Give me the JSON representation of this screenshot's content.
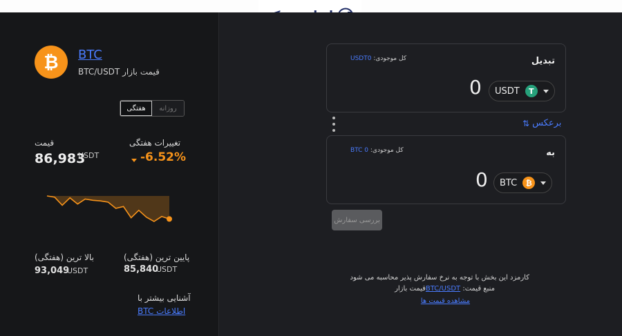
{
  "header": {
    "logo_text": "ایران بروکر"
  },
  "market": {
    "symbol": "BTC",
    "pair_name": "قیمت بازار BTC/USDT",
    "period_options": [
      "روزانه",
      "هفتگی"
    ],
    "active_period": "هفتگی",
    "weekly_change_label": "تغییرات هفتگی",
    "weekly_change": "-6.52%",
    "price_label": "قیمت",
    "price": "86,983",
    "price_unit": "USDT",
    "low_label": "پایین ترین (هفتگی)",
    "low_value": "85,840",
    "low_unit": "USDT",
    "high_label": "بالا ترین (هفتگی)",
    "high_value": "93,049",
    "high_unit": "USDT",
    "more_label": "آشنایی بیشتر با",
    "more_link": "اطلاعات BTC",
    "sparkline": [
      95,
      93,
      80,
      92,
      82,
      90,
      88,
      87,
      85,
      75,
      78,
      60,
      72,
      61,
      54,
      62,
      58
    ]
  },
  "colors": {
    "btc": "#f7931a",
    "usdt": "#26a17b",
    "accent": "#4a7cff"
  },
  "convert": {
    "from_title": "تبدیل",
    "from_balance_label": "کل موجودی:",
    "from_balance_value": "USDT0",
    "from_amount": "0",
    "from_coin": "USDT",
    "from_coin_icon": "tether-icon",
    "swap_label": "برعکس",
    "to_title": "به",
    "to_balance_label": "کل موجودی:",
    "to_balance_value": "BTC 0",
    "to_amount": "0",
    "to_coin": "BTC",
    "to_coin_icon": "bitcoin-icon",
    "review_button": "بررسی سفارش"
  },
  "notes": {
    "fee_note": "کارمزد این بخش با توجه به نرخ سفارش پذیر محاسبه می شود",
    "price_source_label": "منبع قیمت:",
    "price_source_link": "BTC/USDT",
    "price_source_suffix": "قیمت بازار",
    "view_price_link": "مشاهده قیمت ها"
  }
}
